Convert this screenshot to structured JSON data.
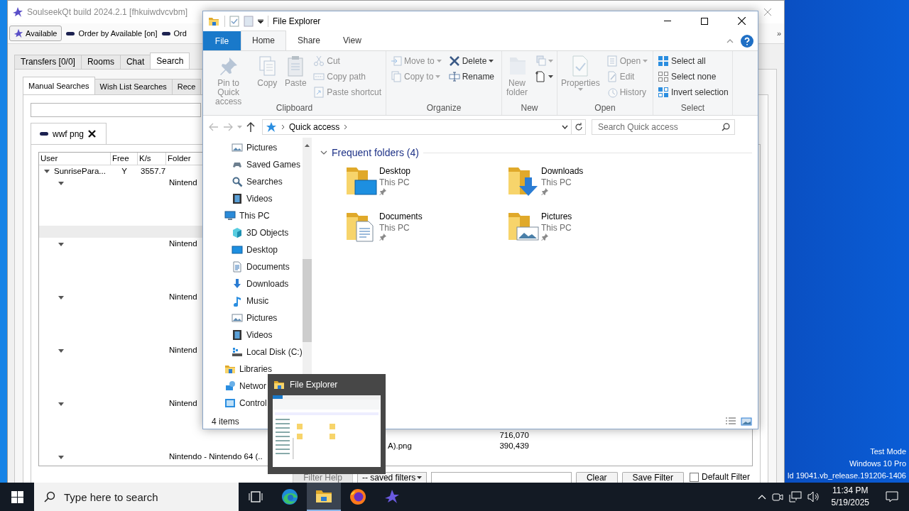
{
  "desktop_text": [
    "Test Mode",
    "Windows 10 Pro",
    "ld 19041.vb_release.191206-1406"
  ],
  "soulseek": {
    "title": "SoulseekQt build 2024.2.1 [fhkuiwdvcvbm]",
    "toolbar": [
      {
        "kind": "status",
        "label": "Available"
      },
      {
        "kind": "toggle",
        "label": "Order by Available [on]"
      },
      {
        "kind": "toggle",
        "label": "Ord"
      }
    ],
    "overflow": "»",
    "tabs": [
      {
        "label": "Transfers [0/0]",
        "selected": false
      },
      {
        "label": "Rooms",
        "selected": false
      },
      {
        "label": "Chat",
        "selected": false
      },
      {
        "label": "Search",
        "selected": true
      }
    ],
    "subtabs": [
      {
        "label": "Manual Searches",
        "selected": true
      },
      {
        "label": "Wish List Searches",
        "selected": false
      },
      {
        "label": "Rece",
        "selected": false
      }
    ],
    "result_tab": {
      "label": "wwf png"
    },
    "columns": [
      "User",
      "Free",
      "K/s",
      "Folder"
    ],
    "results": [
      {
        "user": "SunrisePara...",
        "free": "Y",
        "speed": "3557.7",
        "expanded": true,
        "folders": [
          {
            "name": "Nintend",
            "expanded": true,
            "files": [
              {
                "selected": true
              }
            ]
          },
          {
            "name": "Nintend",
            "expanded": true
          },
          {
            "name": "Nintend",
            "expanded": true
          },
          {
            "name": "Nintend",
            "expanded": true
          },
          {
            "name": "Nintend",
            "expanded": true,
            "files": [
              {
                "selected": false,
                "size": "716,070"
              },
              {
                "selected": false,
                "name": "A).png",
                "size": "390,439"
              }
            ]
          },
          {
            "name": "Nintendo - Nintendo 64 (..",
            "expanded": true
          }
        ]
      }
    ],
    "filter_bar": {
      "help": "Filter Help",
      "saved_filters": "-- saved filters",
      "buttons": [
        "Clear",
        "Save Filter"
      ],
      "default_filter": {
        "label": "Default Filter",
        "checked": false
      }
    }
  },
  "explorer": {
    "title": "File Explorer",
    "ribbon_tabs": [
      {
        "label": "File",
        "kind": "file",
        "selected": false
      },
      {
        "label": "Home",
        "kind": "tab",
        "selected": true
      },
      {
        "label": "Share",
        "kind": "tab",
        "selected": false
      },
      {
        "label": "View",
        "kind": "tab",
        "selected": false
      }
    ],
    "ribbon_groups": [
      {
        "label": "Clipboard",
        "columns": [
          [
            {
              "label": "Pin to Quick access",
              "kind": "pin",
              "large": true,
              "disabled": true,
              "dropdown": false
            }
          ],
          [
            {
              "label": "Copy",
              "kind": "copy",
              "large": true,
              "disabled": true,
              "dropdown": false
            }
          ],
          [
            {
              "label": "Paste",
              "kind": "paste",
              "large": true,
              "disabled": true,
              "dropdown": false
            }
          ],
          [
            {
              "label": "Cut",
              "kind": "cut",
              "large": false,
              "disabled": true,
              "dropdown": false
            },
            {
              "label": "Copy path",
              "kind": "copypath",
              "large": false,
              "disabled": true,
              "dropdown": false
            },
            {
              "label": "Paste shortcut",
              "kind": "shortcut",
              "large": false,
              "disabled": true,
              "dropdown": false
            }
          ]
        ]
      },
      {
        "label": "Organize",
        "columns": [
          [
            {
              "label": "Move to",
              "kind": "moveto",
              "large": false,
              "disabled": true,
              "dropdown": true
            },
            {
              "label": "Copy to",
              "kind": "copyto",
              "large": false,
              "disabled": true,
              "dropdown": true
            }
          ],
          [
            {
              "label": "Delete",
              "kind": "delete",
              "large": false,
              "disabled": false,
              "dropdown": true
            },
            {
              "label": "Rename",
              "kind": "rename",
              "large": false,
              "disabled": false,
              "dropdown": false
            }
          ]
        ]
      },
      {
        "label": "New",
        "columns": [
          [
            {
              "label": "New folder",
              "kind": "newfolder",
              "large": true,
              "disabled": true,
              "dropdown": false
            }
          ],
          [
            {
              "kind": "easyaccess",
              "large": false,
              "disabled": true,
              "dropdown": true
            },
            {
              "kind": "newitem",
              "large": false,
              "disabled": false,
              "dropdown": true
            }
          ]
        ]
      },
      {
        "label": "Open",
        "columns": [
          [
            {
              "label": "Properties",
              "kind": "properties",
              "large": true,
              "disabled": true,
              "dropdown": true
            }
          ],
          [
            {
              "label": "Open",
              "kind": "open",
              "large": false,
              "disabled": true,
              "dropdown": true
            },
            {
              "label": "Edit",
              "kind": "edit",
              "large": false,
              "disabled": true,
              "dropdown": false
            },
            {
              "label": "History",
              "kind": "history",
              "large": false,
              "disabled": true,
              "dropdown": false
            }
          ]
        ]
      },
      {
        "label": "Select",
        "columns": [
          [
            {
              "label": "Select all",
              "kind": "selectall",
              "large": false,
              "disabled": false,
              "dropdown": false
            },
            {
              "label": "Select none",
              "kind": "selectnone",
              "large": false,
              "disabled": false,
              "dropdown": false
            },
            {
              "label": "Invert selection",
              "kind": "invert",
              "large": false,
              "disabled": false,
              "dropdown": false
            }
          ]
        ]
      }
    ],
    "address": "Quick access",
    "search": {
      "placeholder": "Search Quick access"
    },
    "nav_pane": {
      "continued_items": [
        {
          "label": "Pictures",
          "kind": "pictures"
        },
        {
          "label": "Saved Games",
          "kind": "games"
        },
        {
          "label": "Searches",
          "kind": "search"
        },
        {
          "label": "Videos",
          "kind": "videos"
        }
      ],
      "items": [
        {
          "label": "This PC",
          "kind": "pc",
          "children": [
            {
              "label": "3D Objects",
              "kind": "objects"
            },
            {
              "label": "Desktop",
              "kind": "desktop"
            },
            {
              "label": "Documents",
              "kind": "documents"
            },
            {
              "label": "Downloads",
              "kind": "downloads"
            },
            {
              "label": "Music",
              "kind": "music"
            },
            {
              "label": "Pictures",
              "kind": "pictures"
            },
            {
              "label": "Videos",
              "kind": "videos"
            },
            {
              "label": "Local Disk (C:)",
              "kind": "disk"
            }
          ]
        },
        {
          "label": "Libraries",
          "kind": "libraries"
        },
        {
          "label": "Networ",
          "kind": "network"
        },
        {
          "label": "Control",
          "kind": "control-panel"
        }
      ]
    },
    "section": {
      "title": "Frequent folders (4)",
      "expanded": true,
      "folders": [
        {
          "name": "Desktop",
          "location": "This PC",
          "kind": "desktop"
        },
        {
          "name": "Downloads",
          "location": "This PC",
          "kind": "downloads"
        },
        {
          "name": "Documents",
          "location": "This PC",
          "kind": "documents"
        },
        {
          "name": "Pictures",
          "location": "This PC",
          "kind": "pictures"
        }
      ]
    },
    "status": "4 items"
  },
  "thumbnail_popup": {
    "title": "File Explorer"
  },
  "taskbar": {
    "search_placeholder": "Type here to search",
    "apps": [
      {
        "kind": "edge",
        "selected": false
      },
      {
        "kind": "explorer",
        "selected": true
      },
      {
        "kind": "firefox",
        "selected": false
      },
      {
        "kind": "soulseek",
        "selected": false
      }
    ],
    "time": "11:34 PM",
    "date": "5/19/2025"
  }
}
